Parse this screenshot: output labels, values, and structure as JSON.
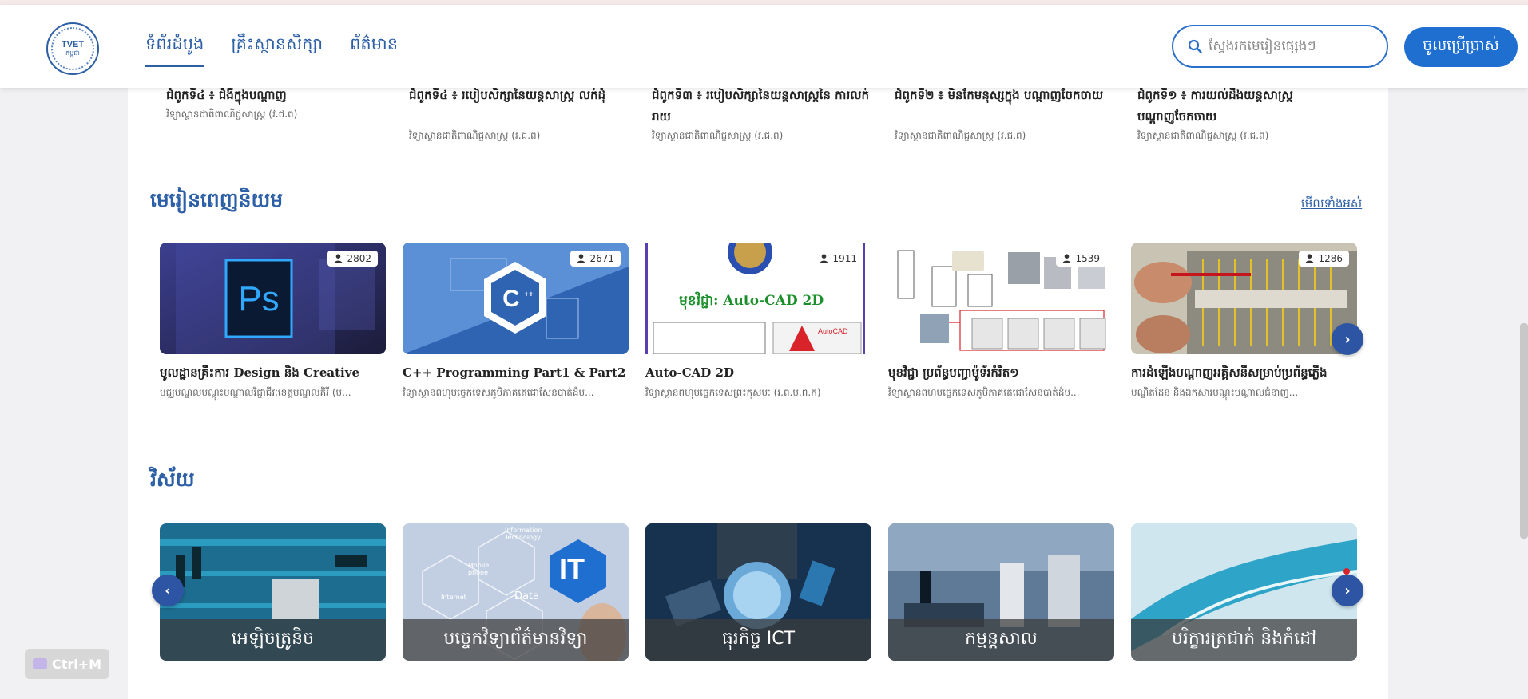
{
  "header": {
    "logo": {
      "line1": "TVET",
      "line2": "កម្ពុជា"
    },
    "nav": [
      {
        "label": "ទំព័រដំបូង",
        "active": true
      },
      {
        "label": "គ្រឹះស្ថានសិក្សា",
        "active": false
      },
      {
        "label": "ព័ត៌មាន",
        "active": false
      }
    ],
    "search_placeholder": "ស្វែងរកមេរៀនផ្សេងៗ",
    "login_label": "ចូលប្រើប្រាស់"
  },
  "prev_row": [
    {
      "title": "ជំពូកទី៤ ៖ ជំងឺក្នុងបណ្ដាញ",
      "sub": "វិទ្យាស្ថានជាតិពាណិជ្ជសាស្ត្រ (វ.ជ.ព)"
    },
    {
      "title": "ជំពូកទី៤ ៖ របៀបសិក្សានៃយន្តសាស្ត្រ លក់ដុំ",
      "sub": "វិទ្យាស្ថានជាតិពាណិជ្ជសាស្ត្រ (វ.ជ.ព)"
    },
    {
      "title": "ជំពូកទី៣ ៖ របៀបសិក្សានៃយន្តសាស្ត្រនៃ ការលក់រាយ",
      "sub": "វិទ្យាស្ថានជាតិពាណិជ្ជសាស្ត្រ (វ.ជ.ព)"
    },
    {
      "title": "ជំពូកទី២ ៖ មិនកែមនុស្សក្នុង បណ្ដាញចែកចាយ",
      "sub": "វិទ្យាស្ថានជាតិពាណិជ្ជសាស្ត្រ (វ.ជ.ព)"
    },
    {
      "title": "ជំពូកទី១ ៖ ការយល់ដឹងយន្តសាស្ត្រ បណ្ដាញចែកចាយ",
      "sub": "វិទ្យាស្ថានជាតិពាណិជ្ជសាស្ត្រ (វ.ជ.ព)"
    }
  ],
  "popular": {
    "title": "មេរៀនពេញនិយម",
    "see_all": "មើលទាំងអស់",
    "courses": [
      {
        "title": "មូលដ្ឋានគ្រឹះការ Design និង Creative",
        "sub": "មជ្ឈមណ្ឌលបណ្ដុះបណ្ដាលវិជ្ជាជីវៈខេត្តមណ្ឌលគិរី (ម...",
        "views": "2802",
        "thumb": "photoshop"
      },
      {
        "title": "C++ Programming Part1 & Part2",
        "sub": "វិទ្យាស្ថានពហុបច្ចេកទេសភូមិភាគតេជោសែនបាត់ដំប...",
        "views": "2671",
        "thumb": "cpp"
      },
      {
        "title": "Auto-CAD 2D",
        "sub": "វិទ្យាស្ថានពហុបច្ចេកទេសព្រះកុសុមៈ (វ.ព.ប.ព.ក)",
        "views": "1911",
        "thumb": "autocad",
        "thumb_text": "មុខវិជ្ជា: Auto-CAD 2D",
        "thumb_badge": "AutoCAD"
      },
      {
        "title": "មុខវិជ្ជា ប្រព័ន្ធបញ្ជាម៉ូទ័រកំរិត១",
        "sub": "វិទ្យាស្ថានពហុបច្ចេកទេសភូមិភាគតេជោសែនបាត់ដំប...",
        "views": "1539",
        "thumb": "motor"
      },
      {
        "title": "ការដំឡើងបណ្ដាញអគ្គិសនីសម្រាប់ប្រព័ន្ធភ្លើង",
        "sub": "បណ្ឌិតដែន និងឯកសារបណ្ដុះបណ្ដាលជំនាញ...",
        "views": "1286",
        "thumb": "electric"
      }
    ]
  },
  "categories": {
    "title": "វិស័យ",
    "items": [
      {
        "label": "អេឡិចត្រូនិច",
        "thumb": "electronics"
      },
      {
        "label": "បច្ចេកវិទ្យាព័ត៌មានវិទ្យា",
        "thumb": "it",
        "thumb_text": [
          "Information Technology",
          "Mobile phone",
          "Data",
          "Internet",
          "IT"
        ]
      },
      {
        "label": "ធុរកិច្ច ICT",
        "thumb": "business"
      },
      {
        "label": "កម្មន្តសាល",
        "thumb": "factory"
      },
      {
        "label": "បរិក្ខារត្រជាក់ និងកំដៅ",
        "thumb": "hvac"
      }
    ]
  },
  "shortcut_hint": "Ctrl+M",
  "colors": {
    "primary": "#2d5fa6",
    "button": "#1f6fd1",
    "arrow": "#2d55a3"
  }
}
